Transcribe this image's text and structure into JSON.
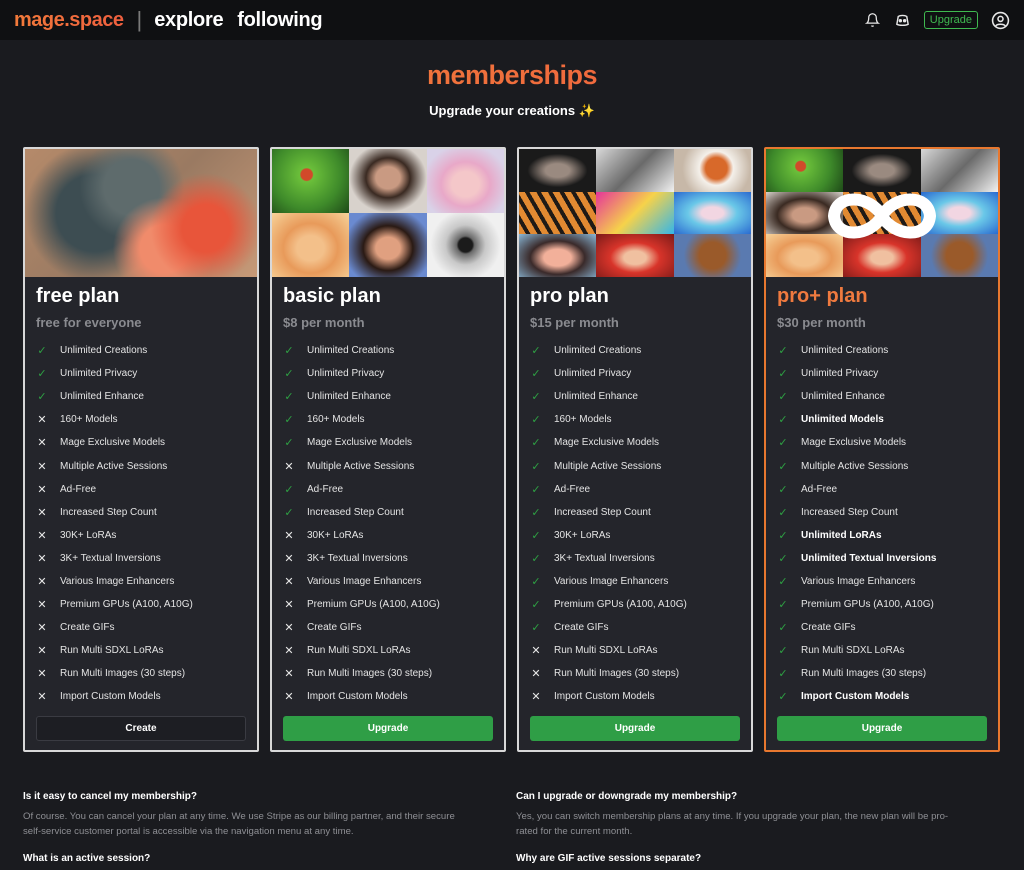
{
  "header": {
    "brand": "mage.space",
    "separator": "|",
    "nav": [
      "explore",
      "following"
    ],
    "upgrade_label": "Upgrade",
    "icons": [
      "bell-icon",
      "discord-icon",
      "user-circle-icon"
    ]
  },
  "hero": {
    "title": "memberships",
    "subtitle": "Upgrade your creations ✨"
  },
  "colors": {
    "brand_orange": "#ef7a3f",
    "check_green": "#2ea043",
    "button_green": "#2f9e46",
    "card_bg": "#24252b",
    "page_bg": "#1a1b1f"
  },
  "plans": [
    {
      "name": "free plan",
      "price": "free for everyone",
      "button": "Create",
      "features": [
        {
          "label": "Unlimited Creations",
          "included": true,
          "bold": false
        },
        {
          "label": "Unlimited Privacy",
          "included": true,
          "bold": false
        },
        {
          "label": "Unlimited Enhance",
          "included": true,
          "bold": false
        },
        {
          "label": "160+ Models",
          "included": false,
          "bold": false
        },
        {
          "label": "Mage Exclusive Models",
          "included": false,
          "bold": false
        },
        {
          "label": "Multiple Active Sessions",
          "included": false,
          "bold": false
        },
        {
          "label": "Ad-Free",
          "included": false,
          "bold": false
        },
        {
          "label": "Increased Step Count",
          "included": false,
          "bold": false
        },
        {
          "label": "30K+ LoRAs",
          "included": false,
          "bold": false
        },
        {
          "label": "3K+ Textual Inversions",
          "included": false,
          "bold": false
        },
        {
          "label": "Various Image Enhancers",
          "included": false,
          "bold": false
        },
        {
          "label": "Premium GPUs (A100, A10G)",
          "included": false,
          "bold": false
        },
        {
          "label": "Create GIFs",
          "included": false,
          "bold": false
        },
        {
          "label": "Run Multi SDXL LoRAs",
          "included": false,
          "bold": false
        },
        {
          "label": "Run Multi Images (30 steps)",
          "included": false,
          "bold": false
        },
        {
          "label": "Import Custom Models",
          "included": false,
          "bold": false
        }
      ]
    },
    {
      "name": "basic plan",
      "price": "$8 per month",
      "button": "Upgrade",
      "features": [
        {
          "label": "Unlimited Creations",
          "included": true,
          "bold": false
        },
        {
          "label": "Unlimited Privacy",
          "included": true,
          "bold": false
        },
        {
          "label": "Unlimited Enhance",
          "included": true,
          "bold": false
        },
        {
          "label": "160+ Models",
          "included": true,
          "bold": false
        },
        {
          "label": "Mage Exclusive Models",
          "included": true,
          "bold": false
        },
        {
          "label": "Multiple Active Sessions",
          "included": false,
          "bold": false
        },
        {
          "label": "Ad-Free",
          "included": true,
          "bold": false
        },
        {
          "label": "Increased Step Count",
          "included": true,
          "bold": false
        },
        {
          "label": "30K+ LoRAs",
          "included": false,
          "bold": false
        },
        {
          "label": "3K+ Textual Inversions",
          "included": false,
          "bold": false
        },
        {
          "label": "Various Image Enhancers",
          "included": false,
          "bold": false
        },
        {
          "label": "Premium GPUs (A100, A10G)",
          "included": false,
          "bold": false
        },
        {
          "label": "Create GIFs",
          "included": false,
          "bold": false
        },
        {
          "label": "Run Multi SDXL LoRAs",
          "included": false,
          "bold": false
        },
        {
          "label": "Run Multi Images (30 steps)",
          "included": false,
          "bold": false
        },
        {
          "label": "Import Custom Models",
          "included": false,
          "bold": false
        }
      ]
    },
    {
      "name": "pro plan",
      "price": "$15 per month",
      "button": "Upgrade",
      "features": [
        {
          "label": "Unlimited Creations",
          "included": true,
          "bold": false
        },
        {
          "label": "Unlimited Privacy",
          "included": true,
          "bold": false
        },
        {
          "label": "Unlimited Enhance",
          "included": true,
          "bold": false
        },
        {
          "label": "160+ Models",
          "included": true,
          "bold": false
        },
        {
          "label": "Mage Exclusive Models",
          "included": true,
          "bold": false
        },
        {
          "label": "Multiple Active Sessions",
          "included": true,
          "bold": false
        },
        {
          "label": "Ad-Free",
          "included": true,
          "bold": false
        },
        {
          "label": "Increased Step Count",
          "included": true,
          "bold": false
        },
        {
          "label": "30K+ LoRAs",
          "included": true,
          "bold": false
        },
        {
          "label": "3K+ Textual Inversions",
          "included": true,
          "bold": false
        },
        {
          "label": "Various Image Enhancers",
          "included": true,
          "bold": false
        },
        {
          "label": "Premium GPUs (A100, A10G)",
          "included": true,
          "bold": false
        },
        {
          "label": "Create GIFs",
          "included": true,
          "bold": false
        },
        {
          "label": "Run Multi SDXL LoRAs",
          "included": false,
          "bold": false
        },
        {
          "label": "Run Multi Images (30 steps)",
          "included": false,
          "bold": false
        },
        {
          "label": "Import Custom Models",
          "included": false,
          "bold": false
        }
      ]
    },
    {
      "name": "pro+ plan",
      "price": "$30 per month",
      "button": "Upgrade",
      "features": [
        {
          "label": "Unlimited Creations",
          "included": true,
          "bold": false
        },
        {
          "label": "Unlimited Privacy",
          "included": true,
          "bold": false
        },
        {
          "label": "Unlimited Enhance",
          "included": true,
          "bold": false
        },
        {
          "label": "Unlimited Models",
          "included": true,
          "bold": true
        },
        {
          "label": "Mage Exclusive Models",
          "included": true,
          "bold": false
        },
        {
          "label": "Multiple Active Sessions",
          "included": true,
          "bold": false
        },
        {
          "label": "Ad-Free",
          "included": true,
          "bold": false
        },
        {
          "label": "Increased Step Count",
          "included": true,
          "bold": false
        },
        {
          "label": "Unlimited LoRAs",
          "included": true,
          "bold": true
        },
        {
          "label": "Unlimited Textual Inversions",
          "included": true,
          "bold": true
        },
        {
          "label": "Various Image Enhancers",
          "included": true,
          "bold": false
        },
        {
          "label": "Premium GPUs (A100, A10G)",
          "included": true,
          "bold": false
        },
        {
          "label": "Create GIFs",
          "included": true,
          "bold": false
        },
        {
          "label": "Run Multi SDXL LoRAs",
          "included": true,
          "bold": false
        },
        {
          "label": "Run Multi Images (30 steps)",
          "included": true,
          "bold": false
        },
        {
          "label": "Import Custom Models",
          "included": true,
          "bold": true
        }
      ]
    }
  ],
  "faq": [
    {
      "question": "Is it easy to cancel my membership?",
      "answer_lines": [
        "Of course. You can cancel your plan at any time. We use Stripe as our billing partner, and their secure",
        "self-service customer portal is accessible via the navigation menu at any time."
      ]
    },
    {
      "question": "Can I upgrade or downgrade my membership?",
      "answer_lines": [
        "Yes, you can switch membership plans at any time. If you upgrade your plan, the new plan will be pro-",
        "rated for the current month."
      ]
    },
    {
      "question": "What is an active session?",
      "answer_lines": []
    },
    {
      "question": "Why are GIF active sessions separate?",
      "answer_lines": []
    }
  ]
}
